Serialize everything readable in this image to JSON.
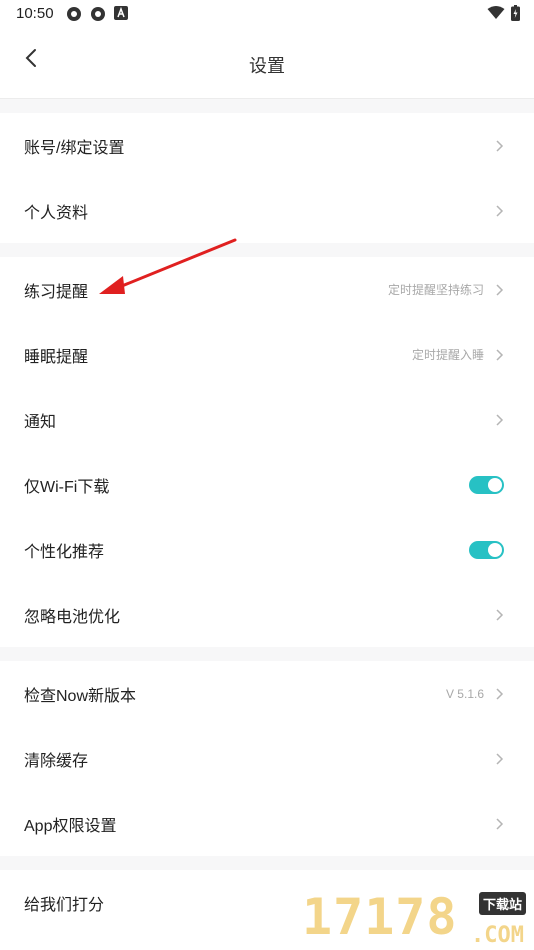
{
  "status": {
    "time": "10:50"
  },
  "header": {
    "title": "设置"
  },
  "groups": [
    {
      "items": [
        {
          "label": "账号/绑定设置"
        },
        {
          "label": "个人资料"
        }
      ]
    },
    {
      "items": [
        {
          "label": "练习提醒",
          "hint": "定时提醒坚持练习"
        },
        {
          "label": "睡眠提醒",
          "hint": "定时提醒入睡"
        },
        {
          "label": "通知"
        },
        {
          "label": "仅Wi-Fi下载",
          "toggle_on": true
        },
        {
          "label": "个性化推荐",
          "toggle_on": true
        },
        {
          "label": "忽略电池优化"
        }
      ]
    },
    {
      "items": [
        {
          "label": "检查Now新版本",
          "hint": "V 5.1.6"
        },
        {
          "label": "清除缓存"
        },
        {
          "label": "App权限设置"
        }
      ]
    },
    {
      "items": [
        {
          "label": "给我们打分"
        }
      ]
    }
  ],
  "colors": {
    "accent": "#27c1c4",
    "annotation_arrow": "#e02020"
  },
  "watermark": {
    "number": "17178",
    "tag": "下载站",
    "suffix": ".COM"
  }
}
